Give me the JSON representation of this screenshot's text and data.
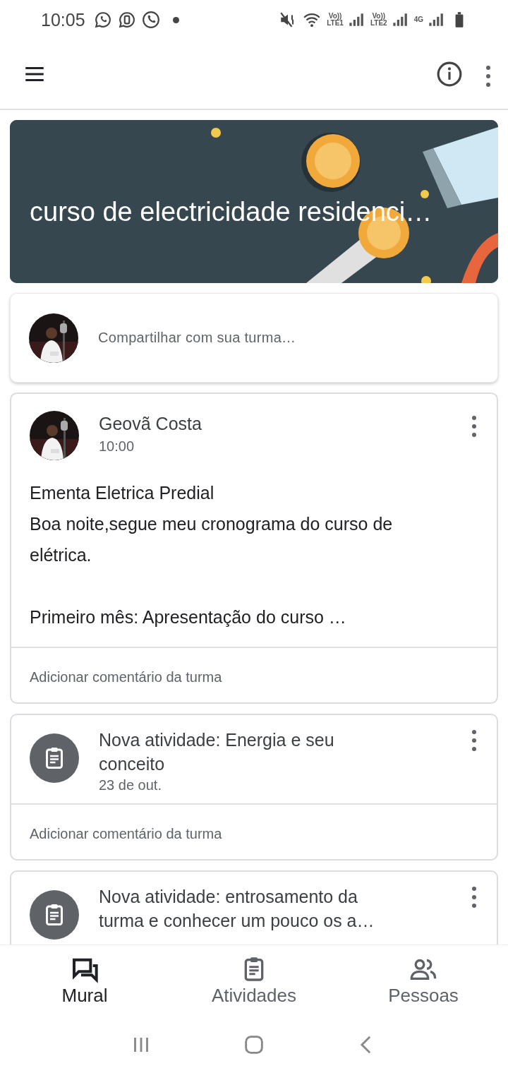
{
  "status_bar": {
    "time": "10:05",
    "networks": [
      {
        "top": "Vo))",
        "bottom": "LTE1"
      },
      {
        "top": "Vo))",
        "bottom": "LTE2"
      },
      {
        "top": "4G"
      }
    ]
  },
  "banner": {
    "title": "curso de electricidade residenci…"
  },
  "share": {
    "placeholder": "Compartilhar com sua turma…"
  },
  "posts": [
    {
      "kind": "announcement",
      "author": "Geovã Costa",
      "time": "10:00",
      "body": "Ementa Eletrica Predial\nBoa noite,segue meu cronograma do curso de elétrica.\n\nPrimeiro mês: Apresentação do curso …",
      "comment": "Adicionar comentário da turma"
    },
    {
      "kind": "activity",
      "title": "Nova atividade: Energia e seu conceito",
      "date": "23 de out.",
      "comment": "Adicionar comentário da turma"
    },
    {
      "kind": "activity",
      "title": "Nova atividade: entrosamento da turma e conhecer um pouco os a…"
    }
  ],
  "tabs": [
    {
      "label": "Mural",
      "selected": true
    },
    {
      "label": "Atividades",
      "selected": false
    },
    {
      "label": "Pessoas",
      "selected": false
    }
  ]
}
